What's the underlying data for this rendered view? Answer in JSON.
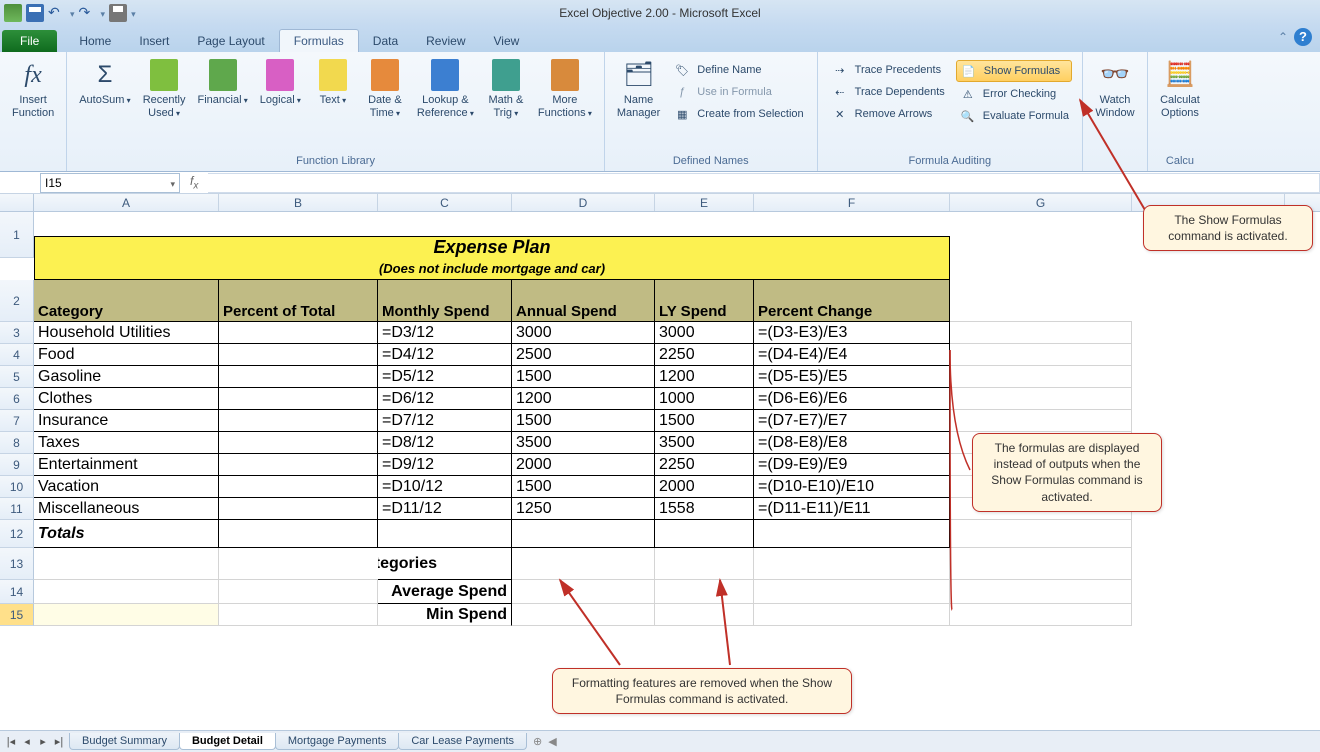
{
  "app": {
    "title": "Excel Objective 2.00  -  Microsoft Excel"
  },
  "tabs": {
    "file": "File",
    "items": [
      "Home",
      "Insert",
      "Page Layout",
      "Formulas",
      "Data",
      "Review",
      "View"
    ],
    "active": "Formulas"
  },
  "ribbon": {
    "insert_function": "Insert\nFunction",
    "function_library": {
      "label": "Function Library",
      "buttons": {
        "autosum": "AutoSum",
        "recently": "Recently\nUsed",
        "financial": "Financial",
        "logical": "Logical",
        "text": "Text",
        "datetime": "Date &\nTime",
        "lookup": "Lookup &\nReference",
        "math": "Math &\nTrig",
        "more": "More\nFunctions"
      }
    },
    "defined_names": {
      "label": "Defined Names",
      "name_manager": "Name\nManager",
      "define_name": "Define Name",
      "use_in_formula": "Use in Formula",
      "create_selection": "Create from Selection"
    },
    "formula_auditing": {
      "label": "Formula Auditing",
      "trace_precedents": "Trace Precedents",
      "trace_dependents": "Trace Dependents",
      "remove_arrows": "Remove Arrows",
      "show_formulas": "Show Formulas",
      "error_checking": "Error Checking",
      "evaluate_formula": "Evaluate Formula"
    },
    "watch_window": "Watch\nWindow",
    "calculation": {
      "label": "Calcu",
      "options": "Calculat\nOptions"
    }
  },
  "name_box": "I15",
  "columns": [
    "A",
    "B",
    "C",
    "D",
    "E",
    "F",
    "G"
  ],
  "sheet": {
    "title": "Expense Plan",
    "subtitle": "(Does not include mortgage and car)",
    "headers": {
      "A": "Category",
      "B": "Percent of Total",
      "C": "Monthly Spend",
      "D": "Annual Spend",
      "E": "LY Spend",
      "F": "Percent Change"
    },
    "rows": [
      {
        "n": 3,
        "A": "Household Utilities",
        "B": "",
        "C": "=D3/12",
        "D": "3000",
        "E": "3000",
        "F": "=(D3-E3)/E3"
      },
      {
        "n": 4,
        "A": "Food",
        "B": "",
        "C": "=D4/12",
        "D": "2500",
        "E": "2250",
        "F": "=(D4-E4)/E4"
      },
      {
        "n": 5,
        "A": "Gasoline",
        "B": "",
        "C": "=D5/12",
        "D": "1500",
        "E": "1200",
        "F": "=(D5-E5)/E5"
      },
      {
        "n": 6,
        "A": "Clothes",
        "B": "",
        "C": "=D6/12",
        "D": "1200",
        "E": "1000",
        "F": "=(D6-E6)/E6"
      },
      {
        "n": 7,
        "A": "Insurance",
        "B": "",
        "C": "=D7/12",
        "D": "1500",
        "E": "1500",
        "F": "=(D7-E7)/E7"
      },
      {
        "n": 8,
        "A": "Taxes",
        "B": "",
        "C": "=D8/12",
        "D": "3500",
        "E": "3500",
        "F": "=(D8-E8)/E8"
      },
      {
        "n": 9,
        "A": "Entertainment",
        "B": "",
        "C": "=D9/12",
        "D": "2000",
        "E": "2250",
        "F": "=(D9-E9)/E9"
      },
      {
        "n": 10,
        "A": "Vacation",
        "B": "",
        "C": "=D10/12",
        "D": "1500",
        "E": "2000",
        "F": "=(D10-E10)/E10"
      },
      {
        "n": 11,
        "A": "Miscellaneous",
        "B": "",
        "C": "=D11/12",
        "D": "1250",
        "E": "1558",
        "F": "=(D11-E11)/E11"
      }
    ],
    "totals_label": "Totals",
    "summary": {
      "num_categories": "Number of Categories",
      "avg_spend": "Average Spend",
      "min_spend": "Min Spend"
    }
  },
  "sheet_tabs": {
    "items": [
      "Budget Summary",
      "Budget Detail",
      "Mortgage Payments",
      "Car Lease Payments"
    ],
    "active": "Budget Detail"
  },
  "callouts": {
    "c1": "The Show Formulas command is activated.",
    "c2": "The formulas are displayed instead of outputs when the Show Formulas command is activated.",
    "c3": "Formatting features are removed when the Show Formulas command is activated."
  },
  "chart_data": {
    "type": "table",
    "title": "Expense Plan",
    "subtitle": "(Does not include mortgage and car)",
    "columns": [
      "Category",
      "Percent of Total",
      "Monthly Spend",
      "Annual Spend",
      "LY Spend",
      "Percent Change"
    ],
    "rows": [
      [
        "Household Utilities",
        "",
        "=D3/12",
        3000,
        3000,
        "=(D3-E3)/E3"
      ],
      [
        "Food",
        "",
        "=D4/12",
        2500,
        2250,
        "=(D4-E4)/E4"
      ],
      [
        "Gasoline",
        "",
        "=D5/12",
        1500,
        1200,
        "=(D5-E5)/E5"
      ],
      [
        "Clothes",
        "",
        "=D6/12",
        1200,
        1000,
        "=(D6-E6)/E6"
      ],
      [
        "Insurance",
        "",
        "=D7/12",
        1500,
        1500,
        "=(D7-E7)/E7"
      ],
      [
        "Taxes",
        "",
        "=D8/12",
        3500,
        3500,
        "=(D8-E8)/E8"
      ],
      [
        "Entertainment",
        "",
        "=D9/12",
        2000,
        2250,
        "=(D9-E9)/E9"
      ],
      [
        "Vacation",
        "",
        "=D10/12",
        1500,
        2000,
        "=(D10-E10)/E10"
      ],
      [
        "Miscellaneous",
        "",
        "=D11/12",
        1250,
        1558,
        "=(D11-E11)/E11"
      ]
    ]
  }
}
